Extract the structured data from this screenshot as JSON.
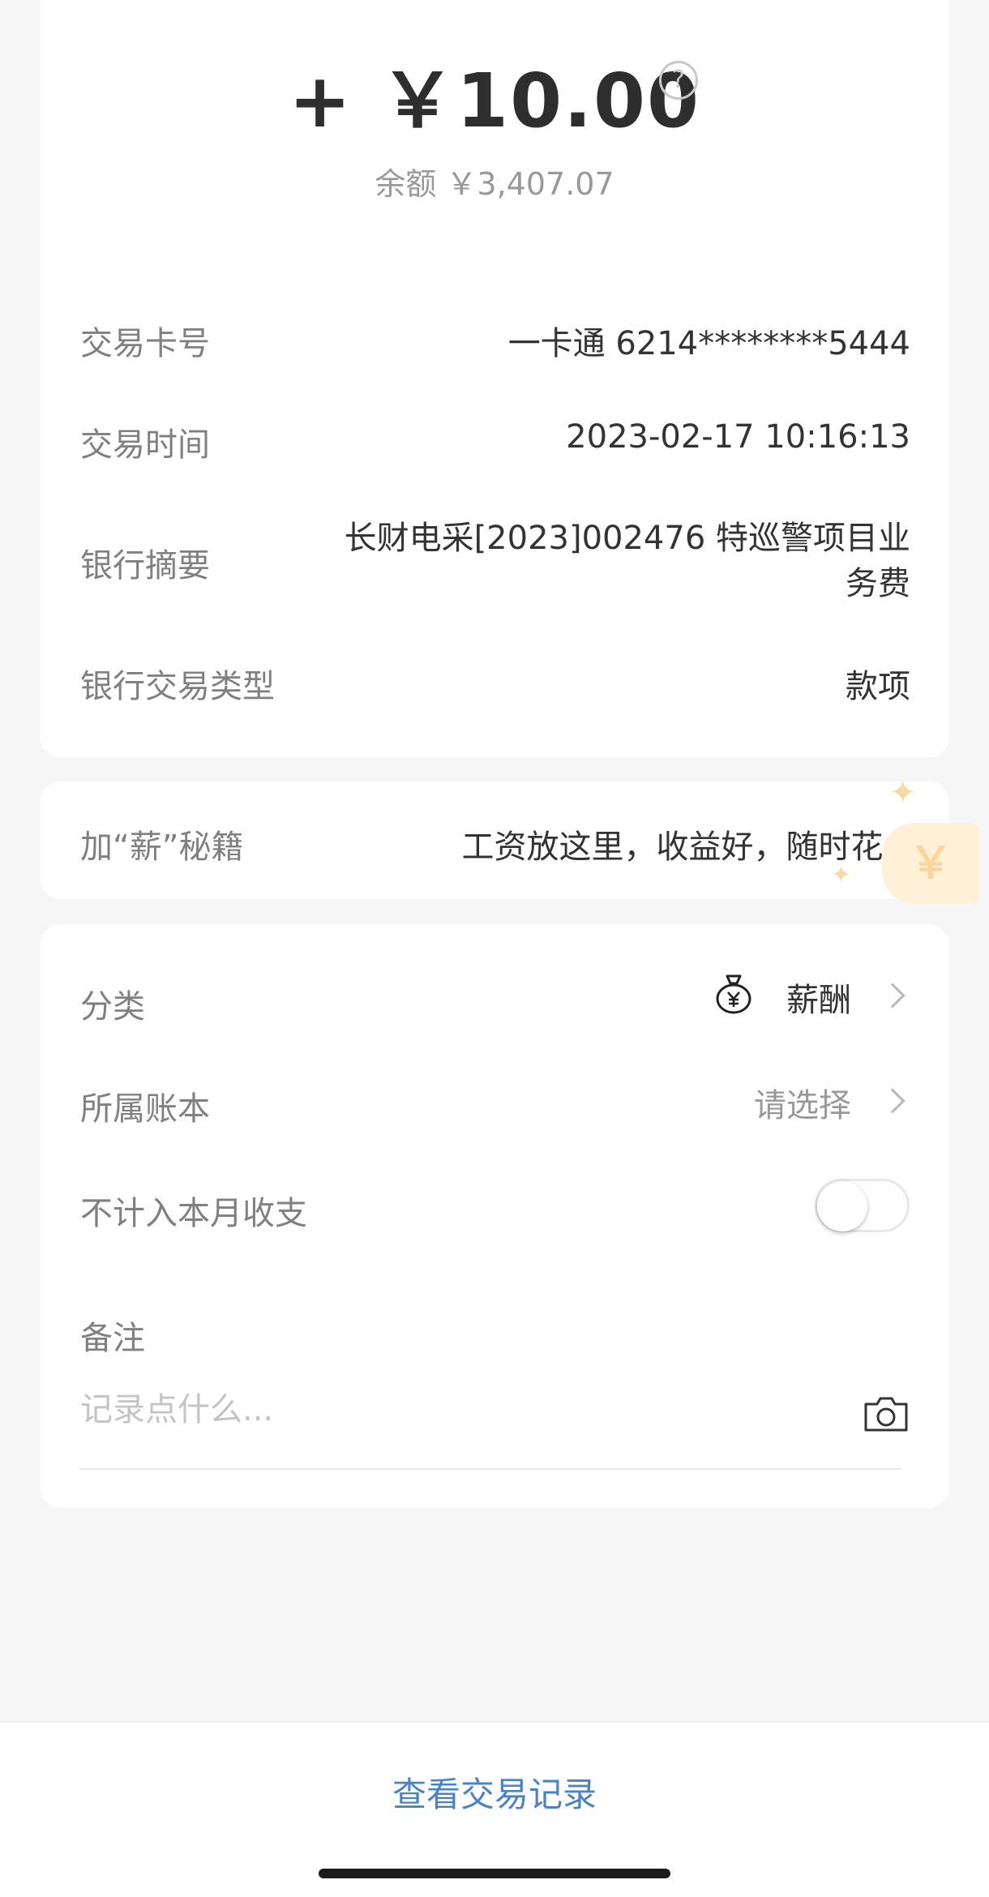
{
  "transaction": {
    "amount": "+ ￥10.00",
    "balance": "余额 ￥3,407.07"
  },
  "details": [
    {
      "label": "交易卡号",
      "value": "一卡通 6214********5444"
    },
    {
      "label": "交易时间",
      "value": "2023-02-17 10:16:13"
    },
    {
      "label": "银行摘要",
      "value_line1": "长财电采[2023]002476 特巡警项目业",
      "value_line2": "务费"
    },
    {
      "label": "银行交易类型",
      "value": "款项"
    }
  ],
  "promo": {
    "label": "加“薪”秘籍",
    "text": "工资放这里，收益好，随时花>",
    "coin_symbol": "￥"
  },
  "category": {
    "label": "分类",
    "value": "薪酬",
    "icon": "money-bag-icon"
  },
  "ledger": {
    "label": "所属账本",
    "value": "请选择"
  },
  "exclude": {
    "label": "不计入本月收支",
    "enabled": false
  },
  "remark": {
    "label": "备注",
    "placeholder": "记录点什么..."
  },
  "footer": {
    "link": "查看交易记录"
  },
  "colors": {
    "link": "#4a83c4",
    "label": "#808080",
    "value": "#333333",
    "background": "#f6f6f6"
  }
}
